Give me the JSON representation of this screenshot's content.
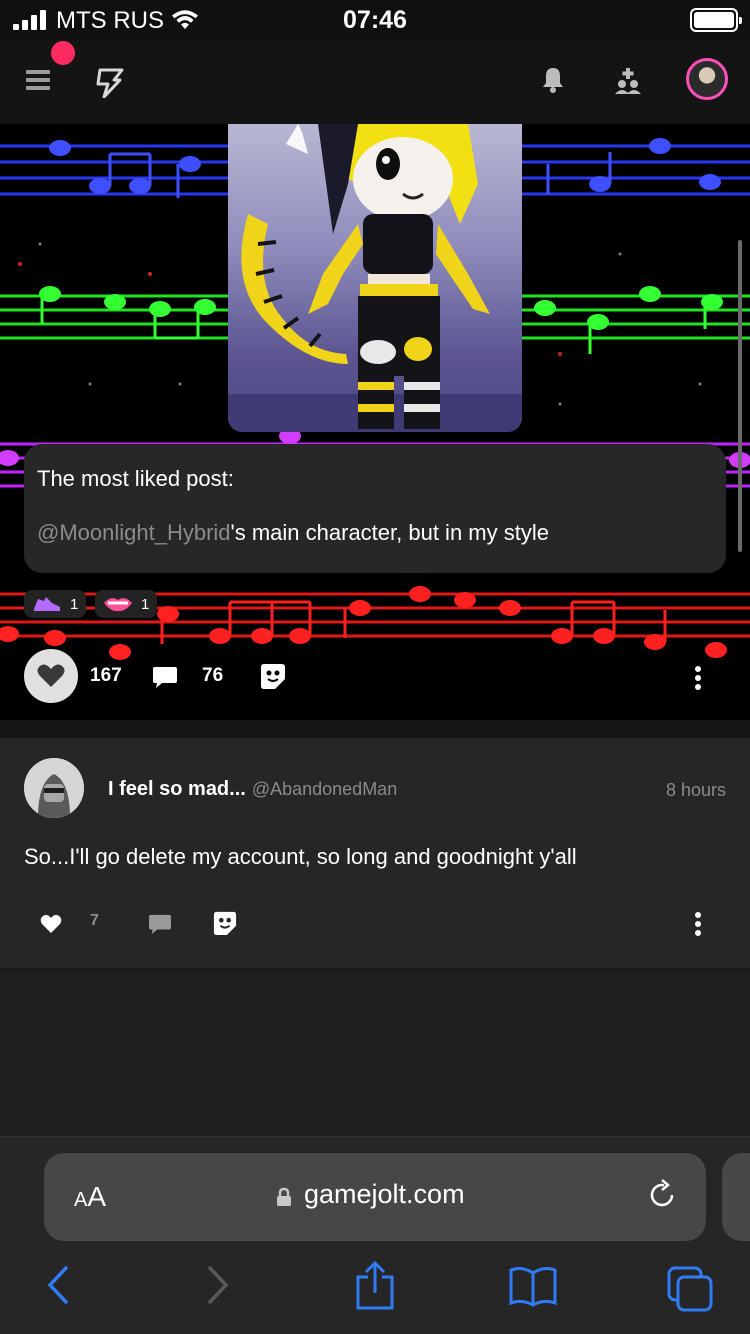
{
  "status_bar": {
    "carrier": "MTS RUS",
    "time": "07:46"
  },
  "app_bar": {
    "icons": [
      "menu-icon",
      "gamejolt-logo-icon",
      "bell-icon",
      "add-friend-icon",
      "user-avatar"
    ],
    "notification_color": "#ff2a5f"
  },
  "featured_post": {
    "caption_line1": "The most liked post:",
    "caption_mention": "@Moonlight_Hybrid",
    "caption_rest": "'s main character, but in my style",
    "reactions": [
      {
        "icon": "purple-shoe-sticker",
        "count": "1"
      },
      {
        "icon": "pink-lips-sticker",
        "count": "1"
      }
    ],
    "likes": "167",
    "comments": "76"
  },
  "second_post": {
    "title": "I feel so mad...",
    "handle": "@AbandonedMan",
    "time": "8 hours",
    "body": "So...I'll go delete my account, so long and goodnight y'all",
    "likes": "7"
  },
  "browser": {
    "text_size_label_big": "A",
    "text_size_label_small": "A",
    "url": "gamejolt.com",
    "toolbar": [
      "back-icon",
      "forward-icon",
      "share-icon",
      "bookmarks-icon",
      "tabs-icon"
    ],
    "accent": "#2f7cf6"
  }
}
